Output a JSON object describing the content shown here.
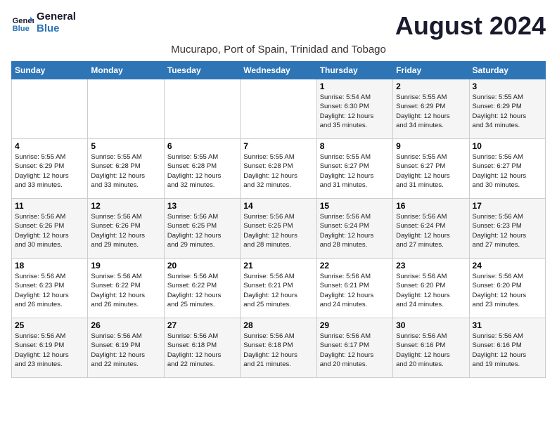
{
  "logo": {
    "line1": "General",
    "line2": "Blue"
  },
  "title": "August 2024",
  "subtitle": "Mucurapo, Port of Spain, Trinidad and Tobago",
  "days_of_week": [
    "Sunday",
    "Monday",
    "Tuesday",
    "Wednesday",
    "Thursday",
    "Friday",
    "Saturday"
  ],
  "weeks": [
    [
      {
        "day": "",
        "info": ""
      },
      {
        "day": "",
        "info": ""
      },
      {
        "day": "",
        "info": ""
      },
      {
        "day": "",
        "info": ""
      },
      {
        "day": "1",
        "info": "Sunrise: 5:54 AM\nSunset: 6:30 PM\nDaylight: 12 hours\nand 35 minutes."
      },
      {
        "day": "2",
        "info": "Sunrise: 5:55 AM\nSunset: 6:29 PM\nDaylight: 12 hours\nand 34 minutes."
      },
      {
        "day": "3",
        "info": "Sunrise: 5:55 AM\nSunset: 6:29 PM\nDaylight: 12 hours\nand 34 minutes."
      }
    ],
    [
      {
        "day": "4",
        "info": "Sunrise: 5:55 AM\nSunset: 6:29 PM\nDaylight: 12 hours\nand 33 minutes."
      },
      {
        "day": "5",
        "info": "Sunrise: 5:55 AM\nSunset: 6:28 PM\nDaylight: 12 hours\nand 33 minutes."
      },
      {
        "day": "6",
        "info": "Sunrise: 5:55 AM\nSunset: 6:28 PM\nDaylight: 12 hours\nand 32 minutes."
      },
      {
        "day": "7",
        "info": "Sunrise: 5:55 AM\nSunset: 6:28 PM\nDaylight: 12 hours\nand 32 minutes."
      },
      {
        "day": "8",
        "info": "Sunrise: 5:55 AM\nSunset: 6:27 PM\nDaylight: 12 hours\nand 31 minutes."
      },
      {
        "day": "9",
        "info": "Sunrise: 5:55 AM\nSunset: 6:27 PM\nDaylight: 12 hours\nand 31 minutes."
      },
      {
        "day": "10",
        "info": "Sunrise: 5:56 AM\nSunset: 6:27 PM\nDaylight: 12 hours\nand 30 minutes."
      }
    ],
    [
      {
        "day": "11",
        "info": "Sunrise: 5:56 AM\nSunset: 6:26 PM\nDaylight: 12 hours\nand 30 minutes."
      },
      {
        "day": "12",
        "info": "Sunrise: 5:56 AM\nSunset: 6:26 PM\nDaylight: 12 hours\nand 29 minutes."
      },
      {
        "day": "13",
        "info": "Sunrise: 5:56 AM\nSunset: 6:25 PM\nDaylight: 12 hours\nand 29 minutes."
      },
      {
        "day": "14",
        "info": "Sunrise: 5:56 AM\nSunset: 6:25 PM\nDaylight: 12 hours\nand 28 minutes."
      },
      {
        "day": "15",
        "info": "Sunrise: 5:56 AM\nSunset: 6:24 PM\nDaylight: 12 hours\nand 28 minutes."
      },
      {
        "day": "16",
        "info": "Sunrise: 5:56 AM\nSunset: 6:24 PM\nDaylight: 12 hours\nand 27 minutes."
      },
      {
        "day": "17",
        "info": "Sunrise: 5:56 AM\nSunset: 6:23 PM\nDaylight: 12 hours\nand 27 minutes."
      }
    ],
    [
      {
        "day": "18",
        "info": "Sunrise: 5:56 AM\nSunset: 6:23 PM\nDaylight: 12 hours\nand 26 minutes."
      },
      {
        "day": "19",
        "info": "Sunrise: 5:56 AM\nSunset: 6:22 PM\nDaylight: 12 hours\nand 26 minutes."
      },
      {
        "day": "20",
        "info": "Sunrise: 5:56 AM\nSunset: 6:22 PM\nDaylight: 12 hours\nand 25 minutes."
      },
      {
        "day": "21",
        "info": "Sunrise: 5:56 AM\nSunset: 6:21 PM\nDaylight: 12 hours\nand 25 minutes."
      },
      {
        "day": "22",
        "info": "Sunrise: 5:56 AM\nSunset: 6:21 PM\nDaylight: 12 hours\nand 24 minutes."
      },
      {
        "day": "23",
        "info": "Sunrise: 5:56 AM\nSunset: 6:20 PM\nDaylight: 12 hours\nand 24 minutes."
      },
      {
        "day": "24",
        "info": "Sunrise: 5:56 AM\nSunset: 6:20 PM\nDaylight: 12 hours\nand 23 minutes."
      }
    ],
    [
      {
        "day": "25",
        "info": "Sunrise: 5:56 AM\nSunset: 6:19 PM\nDaylight: 12 hours\nand 23 minutes."
      },
      {
        "day": "26",
        "info": "Sunrise: 5:56 AM\nSunset: 6:19 PM\nDaylight: 12 hours\nand 22 minutes."
      },
      {
        "day": "27",
        "info": "Sunrise: 5:56 AM\nSunset: 6:18 PM\nDaylight: 12 hours\nand 22 minutes."
      },
      {
        "day": "28",
        "info": "Sunrise: 5:56 AM\nSunset: 6:18 PM\nDaylight: 12 hours\nand 21 minutes."
      },
      {
        "day": "29",
        "info": "Sunrise: 5:56 AM\nSunset: 6:17 PM\nDaylight: 12 hours\nand 20 minutes."
      },
      {
        "day": "30",
        "info": "Sunrise: 5:56 AM\nSunset: 6:16 PM\nDaylight: 12 hours\nand 20 minutes."
      },
      {
        "day": "31",
        "info": "Sunrise: 5:56 AM\nSunset: 6:16 PM\nDaylight: 12 hours\nand 19 minutes."
      }
    ]
  ]
}
